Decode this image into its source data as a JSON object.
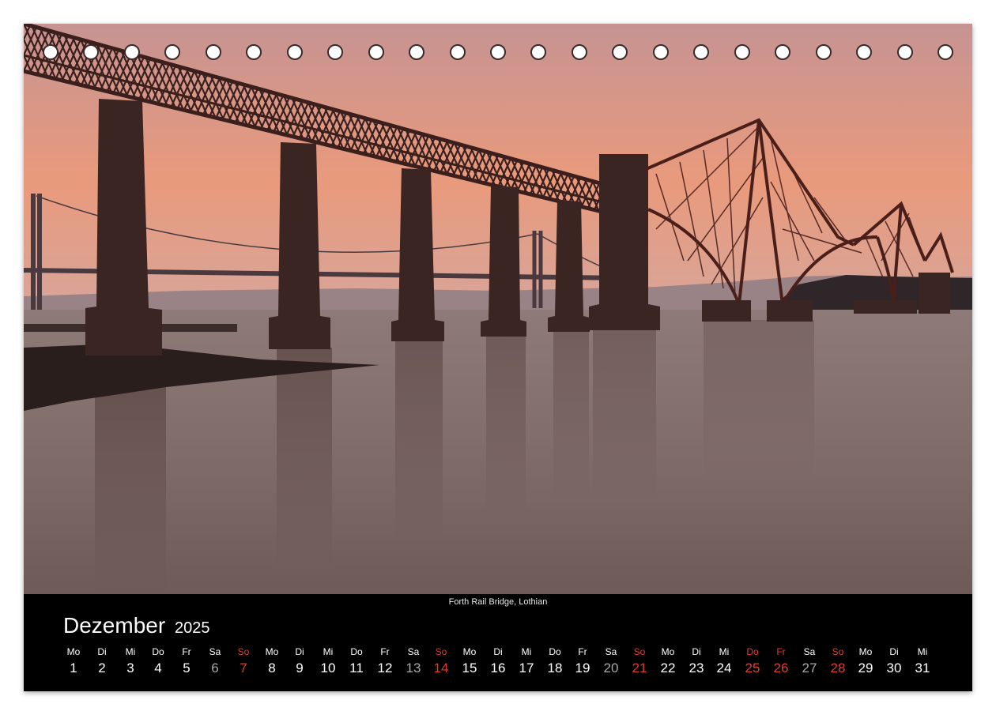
{
  "photo": {
    "subject": "Forth Rail Bridge at sunset",
    "sky_top": "#b98b8a",
    "sky_bottom": "#e89878",
    "water": "#7a6660",
    "bridge": "#3a1f1c"
  },
  "binding_holes": 23,
  "caption": "Forth Rail Bridge, Lothian",
  "month": {
    "name": "Dezember",
    "year": "2025"
  },
  "colors": {
    "footer_bg": "#000000",
    "weekend_sunday": "#e23b2e",
    "saturday_number": "#a8a8a8",
    "text": "#ffffff"
  },
  "days": [
    {
      "wd": "Mo",
      "n": "1",
      "type": "weekday"
    },
    {
      "wd": "Di",
      "n": "2",
      "type": "weekday"
    },
    {
      "wd": "Mi",
      "n": "3",
      "type": "weekday"
    },
    {
      "wd": "Do",
      "n": "4",
      "type": "weekday"
    },
    {
      "wd": "Fr",
      "n": "5",
      "type": "weekday"
    },
    {
      "wd": "Sa",
      "n": "6",
      "type": "sat"
    },
    {
      "wd": "So",
      "n": "7",
      "type": "sun"
    },
    {
      "wd": "Mo",
      "n": "8",
      "type": "weekday"
    },
    {
      "wd": "Di",
      "n": "9",
      "type": "weekday"
    },
    {
      "wd": "Mi",
      "n": "10",
      "type": "weekday"
    },
    {
      "wd": "Do",
      "n": "11",
      "type": "weekday"
    },
    {
      "wd": "Fr",
      "n": "12",
      "type": "weekday"
    },
    {
      "wd": "Sa",
      "n": "13",
      "type": "sat"
    },
    {
      "wd": "So",
      "n": "14",
      "type": "sun"
    },
    {
      "wd": "Mo",
      "n": "15",
      "type": "weekday"
    },
    {
      "wd": "Di",
      "n": "16",
      "type": "weekday"
    },
    {
      "wd": "Mi",
      "n": "17",
      "type": "weekday"
    },
    {
      "wd": "Do",
      "n": "18",
      "type": "weekday"
    },
    {
      "wd": "Fr",
      "n": "19",
      "type": "weekday"
    },
    {
      "wd": "Sa",
      "n": "20",
      "type": "sat"
    },
    {
      "wd": "So",
      "n": "21",
      "type": "sun"
    },
    {
      "wd": "Mo",
      "n": "22",
      "type": "weekday"
    },
    {
      "wd": "Di",
      "n": "23",
      "type": "weekday"
    },
    {
      "wd": "Mi",
      "n": "24",
      "type": "weekday"
    },
    {
      "wd": "Do",
      "n": "25",
      "type": "hol"
    },
    {
      "wd": "Fr",
      "n": "26",
      "type": "hol"
    },
    {
      "wd": "Sa",
      "n": "27",
      "type": "sat"
    },
    {
      "wd": "So",
      "n": "28",
      "type": "sun"
    },
    {
      "wd": "Mo",
      "n": "29",
      "type": "weekday"
    },
    {
      "wd": "Di",
      "n": "30",
      "type": "weekday"
    },
    {
      "wd": "Mi",
      "n": "31",
      "type": "weekday"
    }
  ]
}
